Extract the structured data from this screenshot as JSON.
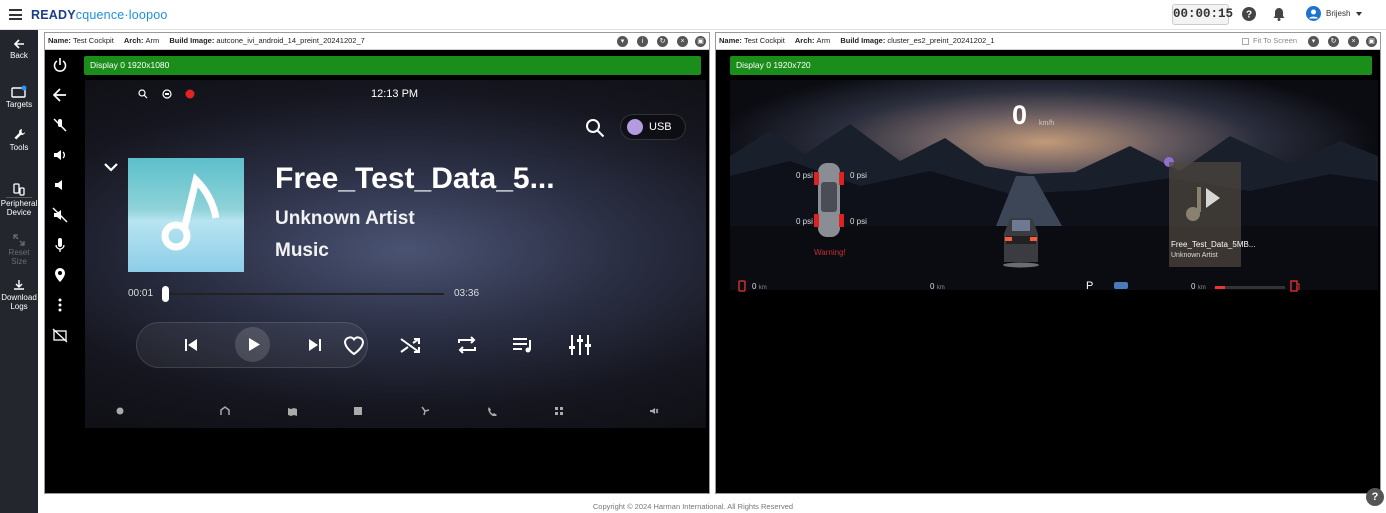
{
  "app": {
    "logo_ready": "READY",
    "logo_rest": "cquence·loopoo",
    "timer": "00:00:15",
    "user_name": "Brijesh",
    "copyright": "Copyright © 2024 Harman International. All Rights Reserved",
    "help_fab": "?"
  },
  "sidebar": {
    "items": [
      {
        "label": "Back",
        "icon": "arrow-left-icon"
      },
      {
        "label": "Targets",
        "icon": "targets-icon"
      },
      {
        "label": "Tools",
        "icon": "wrench-icon"
      },
      {
        "label": "Peripheral Device",
        "icon": "peripheral-icon"
      },
      {
        "label": "Reset Size",
        "icon": "reset-size-icon",
        "disabled": true
      },
      {
        "label": "Download Logs",
        "icon": "download-icon"
      }
    ]
  },
  "panels": [
    {
      "name_label": "Name:",
      "name": "Test Cockpit",
      "arch_label": "Arch:",
      "arch": "Arm",
      "build_label": "Build Image:",
      "build": "autcone_ivi_android_14_preint_20241202_7",
      "display": "Display 0 1920x1080"
    },
    {
      "name_label": "Name:",
      "name": "Test Cockpit",
      "arch_label": "Arch:",
      "arch": "Arm",
      "build_label": "Build Image:",
      "build": "cluster_es2_preint_20241202_1",
      "fit_label": "Fit To Screen",
      "display": "Display 0 1920x720"
    }
  ],
  "ivi": {
    "time": "12:13 PM",
    "usb_label": "USB",
    "track_title": "Free_Test_Data_5...",
    "artist": "Unknown Artist",
    "album": "Music",
    "elapsed": "00:01",
    "duration": "03:36",
    "progress": 0.005
  },
  "cluster": {
    "speed": "0",
    "speed_unit": "km/h",
    "tire_fl": "0 psi",
    "tire_fr": "0 psi",
    "tire_rl": "0 psi",
    "tire_rr": "0 psi",
    "warning": "Warning!",
    "range_left": "0",
    "range_left_unit": "km",
    "odo": "0",
    "odo_unit": "km",
    "gear": "P",
    "range_right": "0",
    "range_right_unit": "km",
    "media_title": "Free_Test_Data_5MB...",
    "media_artist": "Unknown Artist"
  },
  "colors": {
    "display_bar": "#1a8d1a",
    "sidebar_bg": "#23262d",
    "accent": "#1e8fe0",
    "record_dot": "#e02424"
  }
}
